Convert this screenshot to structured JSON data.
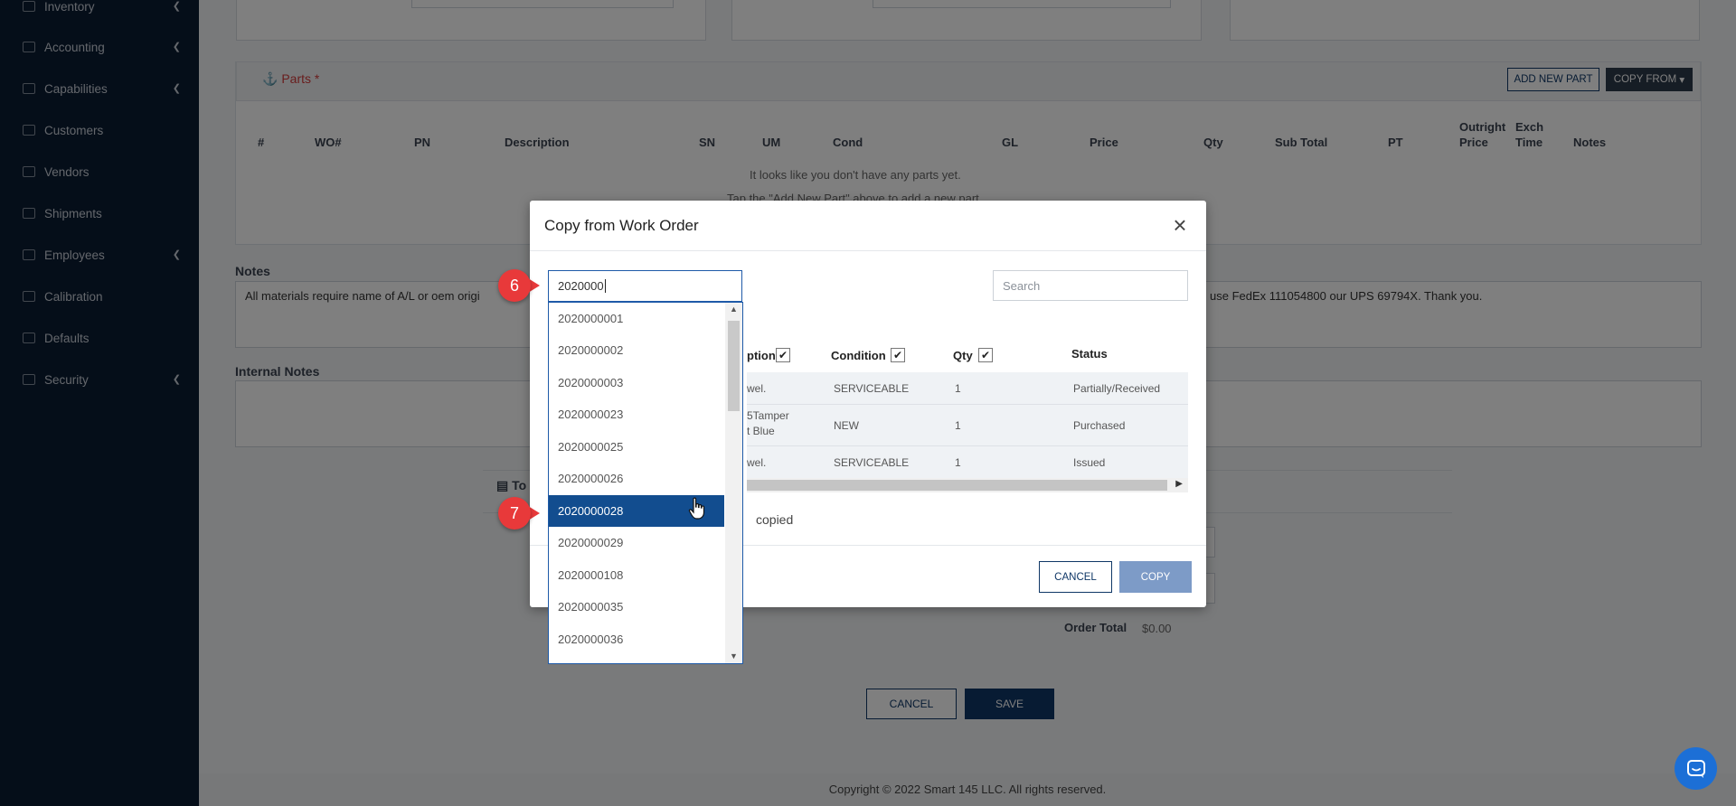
{
  "sidebar": {
    "items": [
      {
        "label": "Inventory",
        "has_submenu": true
      },
      {
        "label": "Accounting",
        "has_submenu": true
      },
      {
        "label": "Capabilities",
        "has_submenu": true
      },
      {
        "label": "Customers",
        "has_submenu": false
      },
      {
        "label": "Vendors",
        "has_submenu": false
      },
      {
        "label": "Shipments",
        "has_submenu": false
      },
      {
        "label": "Employees",
        "has_submenu": true
      },
      {
        "label": "Calibration",
        "has_submenu": false
      },
      {
        "label": "Defaults",
        "has_submenu": false
      },
      {
        "label": "Security",
        "has_submenu": true
      }
    ]
  },
  "parts": {
    "title": "Parts *",
    "add_new_part": "ADD NEW PART",
    "copy_from": "COPY FROM",
    "columns": [
      "#",
      "WO#",
      "PN",
      "Description",
      "SN",
      "UM",
      "Cond",
      "GL",
      "Price",
      "Qty",
      "Sub Total",
      "PT",
      "Notes"
    ],
    "outright_price": [
      "Outright",
      "Price"
    ],
    "exch_time": [
      "Exch",
      "Time"
    ],
    "empty_line1": "It looks like you don't have any parts yet.",
    "empty_line2": "Tap the \"Add New Part\" above to add a new part."
  },
  "notes": {
    "label": "Notes",
    "text_left": "All materials require name of A/L or oem origi",
    "text_right": "use FedEx 111054800 our UPS 69794X. Thank you."
  },
  "internal_notes": {
    "label": "Internal Notes"
  },
  "totals": {
    "label_partial": "To",
    "order_total_label": "Order Total",
    "order_total_value": "$0.00"
  },
  "page_buttons": {
    "cancel": "CANCEL",
    "save": "SAVE"
  },
  "footer": {
    "copyright": "Copyright © 2022 Smart 145 LLC. All rights reserved."
  },
  "modal": {
    "title": "Copy from Work Order",
    "wo_input_value": "2020000",
    "search_placeholder": "Search",
    "grid_headers": {
      "description_partial": "ption",
      "condition": "Condition",
      "qty": "Qty",
      "status": "Status"
    },
    "rows": [
      {
        "desc": "wel.",
        "desc2": "",
        "condition": "SERVICEABLE",
        "qty": "1",
        "status": "Partially/Received"
      },
      {
        "desc": "5Tamper",
        "desc2": "t Blue",
        "condition": "NEW",
        "qty": "1",
        "status": "Purchased"
      },
      {
        "desc": "wel.",
        "desc2": "",
        "condition": "SERVICEABLE",
        "qty": "1",
        "status": "Issued"
      }
    ],
    "copied_text": "copied",
    "cancel": "CANCEL",
    "copy": "COPY"
  },
  "dropdown": {
    "options": [
      "2020000001",
      "2020000002",
      "2020000003",
      "2020000023",
      "2020000025",
      "2020000026",
      "2020000028",
      "2020000029",
      "2020000108",
      "2020000035",
      "2020000036"
    ],
    "selected": "2020000028"
  },
  "annotations": {
    "step_a": "6",
    "step_b": "7"
  },
  "colors": {
    "sidebar": "#0b1c33",
    "primary": "#0f3766",
    "selected": "#124d8f",
    "badge": "#e8393a",
    "copy_disabled": "#7d9bc7",
    "parts_title": "#d33b3b"
  }
}
